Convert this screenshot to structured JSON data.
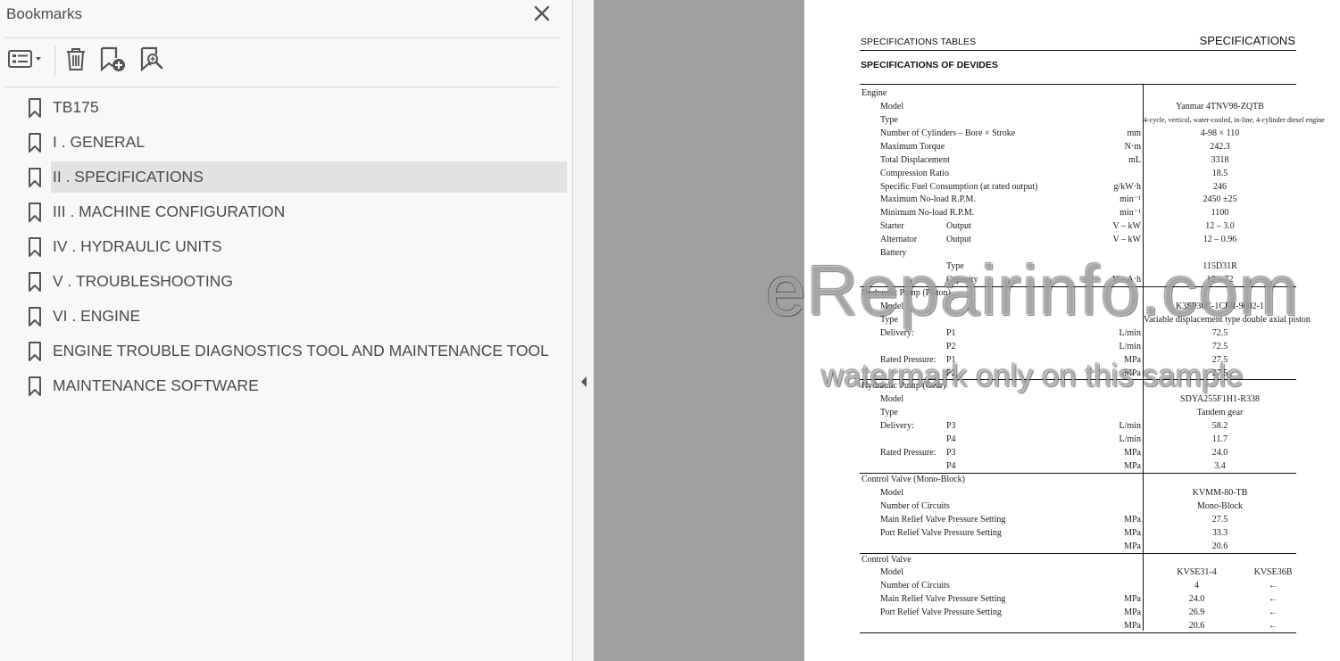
{
  "panel": {
    "title": "Bookmarks",
    "close_icon": "close-icon",
    "toolbar": [
      {
        "name": "options-menu-button",
        "icon": "list-options-icon"
      },
      {
        "name": "delete-bookmark-button",
        "icon": "trash-icon"
      },
      {
        "name": "new-bookmark-button",
        "icon": "add-bookmark-icon"
      },
      {
        "name": "find-bookmark-button",
        "icon": "search-bookmark-icon"
      }
    ],
    "bookmarks": [
      {
        "label": "TB175",
        "selected": false
      },
      {
        "label": "I . GENERAL",
        "selected": false
      },
      {
        "label": "II . SPECIFICATIONS",
        "selected": true
      },
      {
        "label": "III . MACHINE CONFIGURATION",
        "selected": false
      },
      {
        "label": "IV . HYDRAULIC UNITS",
        "selected": false
      },
      {
        "label": "V . TROUBLESHOOTING",
        "selected": false
      },
      {
        "label": "VI . ENGINE",
        "selected": false
      },
      {
        "label": "ENGINE TROUBLE DIAGNOSTICS TOOL AND MAINTENANCE TOOL",
        "selected": false
      },
      {
        "label": "MAINTENANCE SOFTWARE",
        "selected": false
      }
    ]
  },
  "splitter": {
    "icon": "collapse-left-arrow-icon"
  },
  "page": {
    "header_left": "SPECIFICATIONS TABLES",
    "header_right": "SPECIFICATIONS",
    "subtitle": "SPECIFICATIONS OF DEVIDES",
    "rows": [
      {
        "c0": "Engine"
      },
      {
        "c1": "Model",
        "v": "Yanmar 4TNV98-ZQTB"
      },
      {
        "c1": "Type",
        "v": "4-cycle, vertical, water-cooled, in-line, 4-cylinder diesel engine",
        "small": true
      },
      {
        "c1": "Number of Cylinders – Bore × Stroke",
        "u": "mm",
        "v": "4-98 × 110"
      },
      {
        "c1": "Maximum Torque",
        "u": "N·m",
        "v": "242.3"
      },
      {
        "c1": "Total Displacement",
        "u": "mL",
        "v": "3318"
      },
      {
        "c1": "Compression Ratio",
        "v": "18.5"
      },
      {
        "c1": "Specific Fuel Consumption (at rated output)",
        "u": "g/kW·h",
        "v": "246"
      },
      {
        "c1": "Maximum No-load R.P.M.",
        "u": "min⁻¹",
        "v": "2450 ±25"
      },
      {
        "c1": "Minimum No-load R.P.M.",
        "u": "min⁻¹",
        "v": "1100"
      },
      {
        "c1": "Starter",
        "c2": "Output",
        "u": "V – kW",
        "v": "12 – 3.0"
      },
      {
        "c1": "Alternator",
        "c2": "Output",
        "u": "V – kW",
        "v": "12 – 0.96"
      },
      {
        "c1": "Battery"
      },
      {
        "c2": "Type",
        "v": "115D31R"
      },
      {
        "c2": "Capacity",
        "u": "V – A·h",
        "v": "12 – 72",
        "line_after": true
      },
      {
        "c0": "Hydraulic Pump (Piston)"
      },
      {
        "c1": "Model",
        "v": "K3SP36C-1CFR-9002-1"
      },
      {
        "c1": "Type",
        "v": "Variable displacement type double axial piston"
      },
      {
        "c1": "Delivery:",
        "c2": "P1",
        "u": "L/min",
        "v": "72.5"
      },
      {
        "c2": "P2",
        "u": "L/min",
        "v": "72.5"
      },
      {
        "c1": "Rated Pressure:",
        "c2": "P1",
        "u": "MPa",
        "v": "27.5"
      },
      {
        "c2": "P2",
        "u": "MPa",
        "v": "27.5",
        "line_after": true
      },
      {
        "c0": "Hydraulic Pump (Gear)"
      },
      {
        "c1": "Model",
        "v": "SDYA255F1H1-R338"
      },
      {
        "c1": "Type",
        "v": "Tandem gear"
      },
      {
        "c1": "Delivery:",
        "c2": "P3",
        "u": "L/min",
        "v": "58.2"
      },
      {
        "c2": "P4",
        "u": "L/min",
        "v": "11.7"
      },
      {
        "c1": "Rated Pressure:",
        "c2": "P3",
        "u": "MPa",
        "v": "24.0"
      },
      {
        "c2": "P4",
        "u": "MPa",
        "v": "3.4",
        "line_after": true
      },
      {
        "c0": "Control Valve (Mono-Block)"
      },
      {
        "c1": "Model",
        "v": "KVMM-80-TB"
      },
      {
        "c1": "Number of Circuits",
        "v": "Mono-Block"
      },
      {
        "c1": "Main Relief Valve Pressure Setting",
        "u": "MPa",
        "v": "27.5"
      },
      {
        "c1": "Port Relief Valve Pressure Setting",
        "u": "MPa",
        "v": "33.3"
      },
      {
        "u": "MPa",
        "v": "20.6",
        "line_after": true
      },
      {
        "c0": "Control Valve"
      },
      {
        "c1": "Model",
        "v": "KVSE31-4",
        "v2": "KVSE36B"
      },
      {
        "c1": "Number of Circuits",
        "v": "4",
        "v2": "←"
      },
      {
        "c1": "Main Relief Valve Pressure Setting",
        "u": "MPa",
        "v": "24.0",
        "v2": "←"
      },
      {
        "c1": "Port Relief Valve Pressure Setting",
        "u": "MPa",
        "v": "26.9",
        "v2": "←"
      },
      {
        "u": "MPa",
        "v": "20.6",
        "v2": "←",
        "line_after": true
      }
    ],
    "watermark_main": "eRepairinfo.com",
    "watermark_sub": "watermark only on this sample"
  }
}
